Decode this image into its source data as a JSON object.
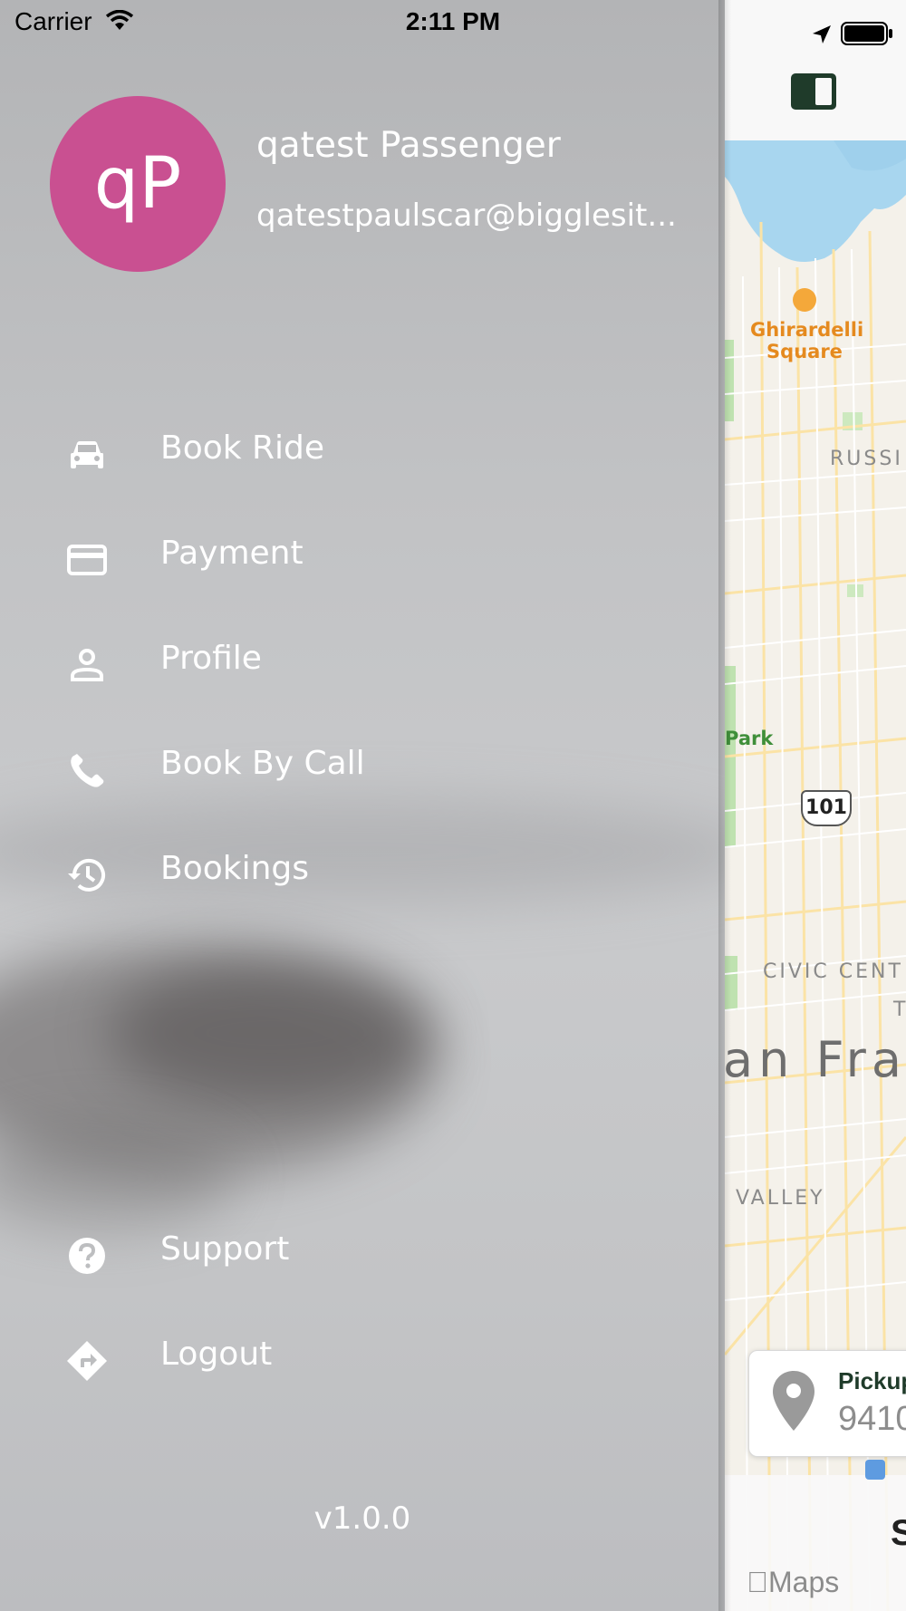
{
  "status_bar": {
    "carrier": "Carrier",
    "time": "2:11 PM"
  },
  "drawer": {
    "avatar_initials": "qP",
    "avatar_color": "#c95091",
    "user_name": "qatest Passenger",
    "user_email": "qatestpaulscar@bigglesit...",
    "menu": [
      {
        "label": "Book Ride",
        "icon": "car-icon"
      },
      {
        "label": "Payment",
        "icon": "credit-card-icon"
      },
      {
        "label": "Profile",
        "icon": "person-icon"
      },
      {
        "label": "Book By Call",
        "icon": "phone-icon"
      },
      {
        "label": "Bookings",
        "icon": "history-icon"
      }
    ],
    "footer_menu": [
      {
        "label": "Support",
        "icon": "help-icon"
      },
      {
        "label": "Logout",
        "icon": "directions-icon"
      }
    ],
    "version": "v1.0.0"
  },
  "map": {
    "labels": {
      "ghirardelli_line1": "Ghirardelli",
      "ghirardelli_line2": "Square",
      "russian_hill": "RUSSI",
      "park": "Park",
      "highway": "101",
      "civic_center": "CIVIC CENT",
      "city": "an Fra",
      "valley": "VALLEY",
      "t_label": "T",
      "attribution": "Maps"
    },
    "pickup": {
      "title": "Pickup",
      "value": "9410"
    },
    "sheet_letter": "S"
  }
}
